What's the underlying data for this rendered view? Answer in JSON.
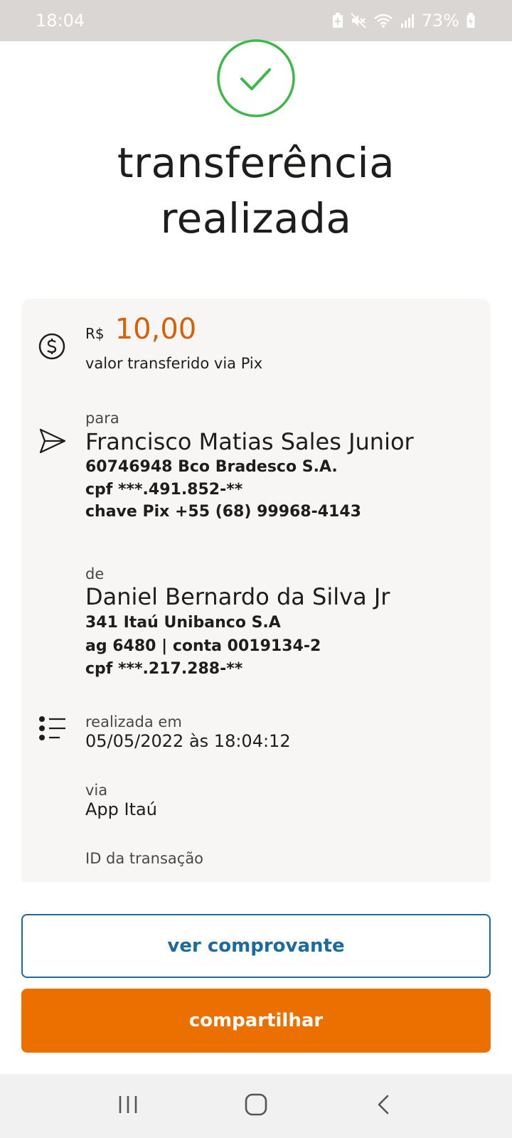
{
  "status_bar": {
    "time": "18:04",
    "battery": "73%",
    "icons": [
      "battery-saver-icon",
      "mute-icon",
      "wifi-icon",
      "signal-icon",
      "charging-icon"
    ]
  },
  "header": {
    "title_line1": "transferência",
    "title_line2": "realizada",
    "success_icon": "check-circle-icon"
  },
  "amount": {
    "currency": "R$",
    "value": "10,00",
    "label": "valor transferido via Pix"
  },
  "recipient": {
    "label": "para",
    "name": "Francisco Matias Sales Junior",
    "bank": "60746948 Bco Bradesco S.A.",
    "cpf": "cpf ***.491.852-**",
    "pix_key": "chave Pix +55 (68) 99968-4143"
  },
  "sender": {
    "label": "de",
    "name": "Daniel Bernardo da Silva Jr",
    "bank": "341 Itaú Unibanco S.A",
    "account": "ag 6480 | conta 0019134-2",
    "cpf": "cpf ***.217.288-**"
  },
  "details": {
    "date_label": "realizada em",
    "date_value": "05/05/2022 às 18:04:12",
    "via_label": "via",
    "via_value": "App Itaú",
    "id_label": "ID da transação"
  },
  "actions": {
    "view_receipt": "ver comprovante",
    "share": "compartilhar"
  },
  "colors": {
    "accent_orange": "#ec7000",
    "amount_orange": "#d4620a",
    "link_blue": "#1b6aa0",
    "success_green": "#3cb949"
  }
}
